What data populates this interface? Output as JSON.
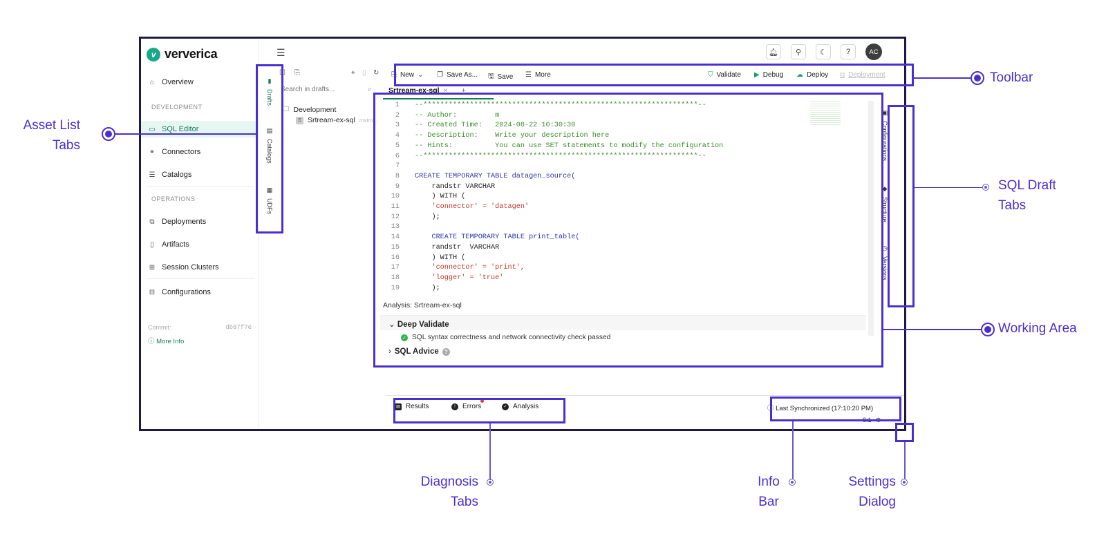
{
  "app": {
    "brand": "ververica",
    "avatar_initials": "AC"
  },
  "sidebar": {
    "overview": "Overview",
    "section_development": "DEVELOPMENT",
    "sql_editor": "SQL Editor",
    "connectors": "Connectors",
    "catalogs": "Catalogs",
    "section_operations": "OPERATIONS",
    "deployments": "Deployments",
    "artifacts": "Artifacts",
    "session_clusters": "Session Clusters",
    "configurations": "Configurations",
    "commit_label": "Commit:",
    "commit_hash": "db87f7e",
    "more_info": "More Info"
  },
  "asset_tabs": {
    "drafts": "Drafts",
    "catalogs": "Catalogs",
    "udfs": "UDFs"
  },
  "drafts_panel": {
    "search_placeholder": "Search in drafts...",
    "folder": "Development",
    "file": "Srtream-ex-sql",
    "file_suffix": "mstm..."
  },
  "toolbar": {
    "new": "New",
    "save_as": "Save As...",
    "save": "Save",
    "more": "More",
    "validate": "Validate",
    "debug": "Debug",
    "deploy": "Deploy",
    "deployment": "Deployment"
  },
  "editor": {
    "tab_name": "Srtream-ex-sql",
    "lines": [
      {
        "n": "1",
        "t": "--*****************************************************************--",
        "c": "cm"
      },
      {
        "n": "2",
        "t": "-- Author:         m",
        "c": "cm"
      },
      {
        "n": "3",
        "t": "-- Created Time:   2024-08-22 10:30:30",
        "c": "cm"
      },
      {
        "n": "4",
        "t": "-- Description:    Write your description here",
        "c": "cm"
      },
      {
        "n": "5",
        "t": "-- Hints:          You can use SET statements to modify the configuration",
        "c": "cm"
      },
      {
        "n": "6",
        "t": "--*****************************************************************--",
        "c": "cm"
      },
      {
        "n": "7",
        "t": "",
        "c": "pl"
      },
      {
        "n": "8",
        "t": "CREATE TEMPORARY TABLE datagen_source(",
        "c": "kw"
      },
      {
        "n": "9",
        "t": "    randstr VARCHAR",
        "c": "pl"
      },
      {
        "n": "10",
        "t": "    ) WITH (",
        "c": "pl"
      },
      {
        "n": "11",
        "t": "    'connector' = 'datagen'",
        "c": "str"
      },
      {
        "n": "12",
        "t": "    );",
        "c": "pl"
      },
      {
        "n": "13",
        "t": "",
        "c": "pl"
      },
      {
        "n": "14",
        "t": "    CREATE TEMPORARY TABLE print_table(",
        "c": "kw"
      },
      {
        "n": "15",
        "t": "    randstr  VARCHAR",
        "c": "pl"
      },
      {
        "n": "16",
        "t": "    ) WITH (",
        "c": "pl"
      },
      {
        "n": "17",
        "t": "    'connector' = 'print',",
        "c": "str"
      },
      {
        "n": "18",
        "t": "    'logger' = 'true'",
        "c": "str"
      },
      {
        "n": "19",
        "t": "    );",
        "c": "pl"
      }
    ]
  },
  "analysis": {
    "title": "Analysis: Srtream-ex-sql",
    "deep_validate": "Deep Validate",
    "deep_validate_msg": "SQL syntax correctness and network connectivity check passed",
    "sql_advice": "SQL Advice"
  },
  "draft_tabs": {
    "configurations": "Configurations",
    "structure": "Structure",
    "versions": "Versions"
  },
  "diagnosis": {
    "results": "Results",
    "errors": "Errors",
    "analysis": "Analysis"
  },
  "info_bar": {
    "text": "Last Synchronized  (17:10:20 PM)"
  },
  "status": {
    "cursor": "8:1"
  },
  "callouts": {
    "asset_list_1": "Asset List",
    "asset_list_2": "Tabs",
    "toolbar": "Toolbar",
    "sql_draft_1": "SQL Draft",
    "sql_draft_2": "Tabs",
    "working_area": "Working Area",
    "diagnosis_1": "Diagnosis",
    "diagnosis_2": "Tabs",
    "info_1": "Info",
    "info_2": "Bar",
    "settings_1": "Settings",
    "settings_2": "Dialog"
  },
  "icons": [
    "home-icon",
    "code-icon",
    "connector-icon",
    "catalog-icon",
    "deploy-icon",
    "file-icon",
    "cluster-icon",
    "config-icon",
    "bell-icon",
    "rocket-icon",
    "moon-icon",
    "help-icon",
    "menu-icon"
  ],
  "colors": {
    "accent": "#167a5b",
    "highlight": "#4a2fd0",
    "frame": "#1e1942"
  }
}
